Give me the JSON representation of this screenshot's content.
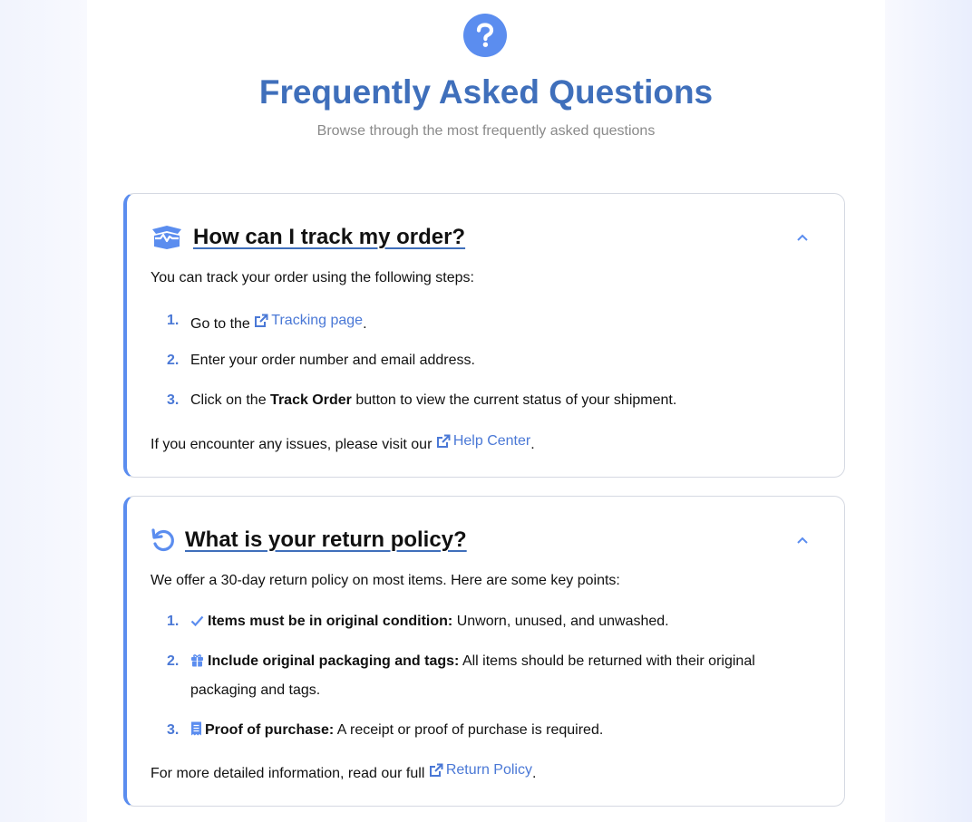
{
  "header": {
    "title": "Frequently Asked Questions",
    "subtitle": "Browse through the most frequently asked questions",
    "icon": "question-circle-icon"
  },
  "colors": {
    "accent": "#5b8def",
    "title": "#3f6fbb",
    "link": "#4a78d6",
    "subtitle": "#8a8a8a"
  },
  "faqs": [
    {
      "icon": "box-open-icon",
      "question": "How can I track my order?",
      "expanded": true,
      "intro": "You can track your order using the following steps:",
      "steps": [
        {
          "number": "1.",
          "text_before": "Go to the",
          "link": "Tracking page",
          "text_after": "."
        },
        {
          "number": "2.",
          "text": "Enter your order number and email address."
        },
        {
          "number": "3.",
          "text_before": "Click on the",
          "bold": "Track Order",
          "text_after": "button to view the current status of your shipment."
        }
      ],
      "footer": {
        "text": "If you encounter any issues, please visit our",
        "link": "Help Center",
        "text_after": "."
      }
    },
    {
      "icon": "undo-icon",
      "question": "What is your return policy?",
      "expanded": true,
      "intro": "We offer a 30-day return policy on most items. Here are some key points:",
      "points": [
        {
          "number": "1.",
          "icon": "check-icon",
          "bold": "Items must be in original condition:",
          "text": "Unworn, unused, and unwashed."
        },
        {
          "number": "2.",
          "icon": "gift-icon",
          "bold": "Include original packaging and tags:",
          "text": "All items should be returned with their original",
          "text_line2": "packaging and tags."
        },
        {
          "number": "3.",
          "icon": "receipt-icon",
          "bold": "Proof of purchase:",
          "text": "A receipt or proof of purchase is required."
        }
      ],
      "footer": {
        "text": "For more detailed information, read our full",
        "link": "Return Policy",
        "text_after": "."
      }
    }
  ]
}
